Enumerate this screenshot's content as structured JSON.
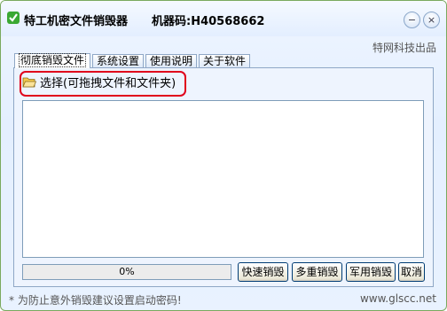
{
  "window": {
    "title": "特工机密文件销毁器",
    "machine_code": "机器码:H40568662",
    "minimize_glyph": "−",
    "close_glyph": "×",
    "publisher": "特网科技出品"
  },
  "tabs": [
    {
      "label": "彻底销毁文件",
      "active": true
    },
    {
      "label": "系统设置",
      "active": false
    },
    {
      "label": "使用说明",
      "active": false
    },
    {
      "label": "关于软件",
      "active": false
    }
  ],
  "main": {
    "select_label": "选择(可拖拽文件和文件夹)",
    "progress_text": "0%",
    "progress": 0,
    "buttons": {
      "fast": "快速销毁",
      "multi": "多重销毁",
      "military": "军用销毁",
      "cancel": "取消"
    }
  },
  "status": {
    "tip": "* 为防止意外销毁建议设置启动密码!",
    "website": "www.glscc.net"
  },
  "colors": {
    "highlight": "#e0001b",
    "app_icon": "#3aa832",
    "folder": "#f2c94c"
  }
}
